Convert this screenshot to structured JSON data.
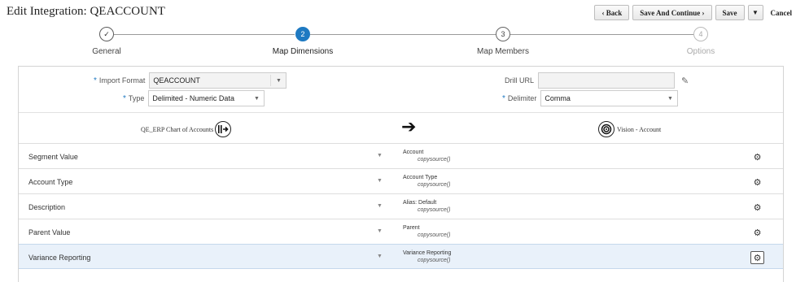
{
  "page": {
    "title": "Edit Integration: QEACCOUNT"
  },
  "toolbar": {
    "back": "‹  Back",
    "save_continue": "Save And Continue  ›",
    "save": "Save",
    "more": "▼",
    "cancel": "Cancel"
  },
  "train": {
    "steps": [
      {
        "label": "General",
        "marker": "✓",
        "state": "done"
      },
      {
        "label": "Map Dimensions",
        "marker": "2",
        "state": "current"
      },
      {
        "label": "Map Members",
        "marker": "3",
        "state": "todo"
      },
      {
        "label": "Options",
        "marker": "4",
        "state": "disabled"
      }
    ]
  },
  "form": {
    "required_mark": "*",
    "import_format_label": "Import Format",
    "import_format_value": "QEACCOUNT",
    "type_label": "Type",
    "type_value": "Delimited - Numeric Data",
    "drill_url_label": "Drill URL",
    "drill_url_value": "",
    "delimiter_label": "Delimiter",
    "delimiter_value": "Comma"
  },
  "mapping": {
    "source_name": "QE_ERP Chart of Accounts",
    "source_icon": "source-system-icon",
    "arrow_icon": "right-arrow-icon",
    "target_name": "Vision - Account",
    "target_icon": "target-icon",
    "rows": [
      {
        "source": "Segment Value",
        "target": "Account",
        "expression": "copysource()"
      },
      {
        "source": "Account Type",
        "target": "Account Type",
        "expression": "copysource()"
      },
      {
        "source": "Description",
        "target": "Alias: Default",
        "expression": "copysource()"
      },
      {
        "source": "Parent Value",
        "target": "Parent",
        "expression": "copysource()"
      },
      {
        "source": "Variance Reporting",
        "target": "Variance Reporting",
        "expression": "copysource()"
      }
    ]
  },
  "colors": {
    "accent": "#1f7ac2",
    "selected_row": "#e9f1fa"
  }
}
